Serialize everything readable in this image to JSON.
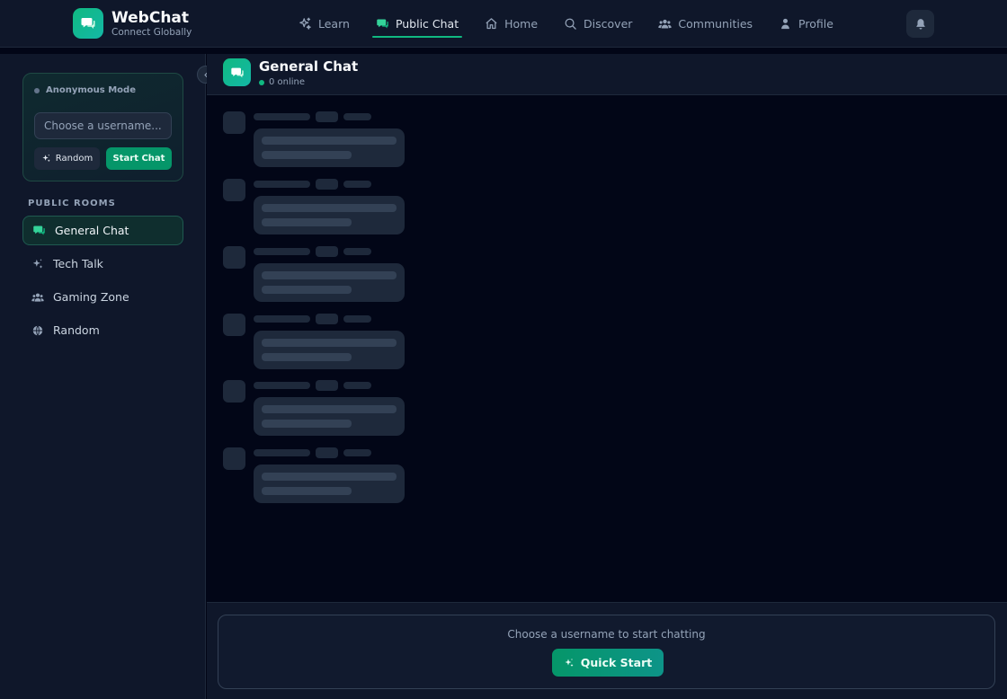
{
  "brand": {
    "name": "WebChat",
    "tagline": "Connect Globally"
  },
  "nav": {
    "items": [
      {
        "label": "Learn",
        "icon": "sparkles-icon"
      },
      {
        "label": "Public Chat",
        "icon": "chat-icon",
        "active": true
      },
      {
        "label": "Home",
        "icon": "home-icon"
      },
      {
        "label": "Discover",
        "icon": "search-icon"
      },
      {
        "label": "Communities",
        "icon": "users-icon"
      },
      {
        "label": "Profile",
        "icon": "user-icon"
      }
    ],
    "notifications_icon": "bell-icon"
  },
  "sidebar": {
    "anon": {
      "title": "Anonymous Mode",
      "username_placeholder": "Choose a username...",
      "username_value": "",
      "random_label": "Random",
      "start_label": "Start Chat"
    },
    "rooms_title": "PUBLIC ROOMS",
    "rooms": [
      {
        "label": "General Chat",
        "icon": "chat-icon",
        "active": true
      },
      {
        "label": "Tech Talk",
        "icon": "sparkles-icon"
      },
      {
        "label": "Gaming Zone",
        "icon": "users-icon"
      },
      {
        "label": "Random",
        "icon": "globe-icon"
      }
    ]
  },
  "chat": {
    "title": "General Chat",
    "online_text": "0 online",
    "loading_placeholders": 6
  },
  "composer": {
    "prompt": "Choose a username to start chatting",
    "quick_start_label": "Quick Start"
  },
  "colors": {
    "accent": "#10b981",
    "background": "#020617",
    "panel": "#0f172a",
    "skeleton": "#1e293b"
  }
}
